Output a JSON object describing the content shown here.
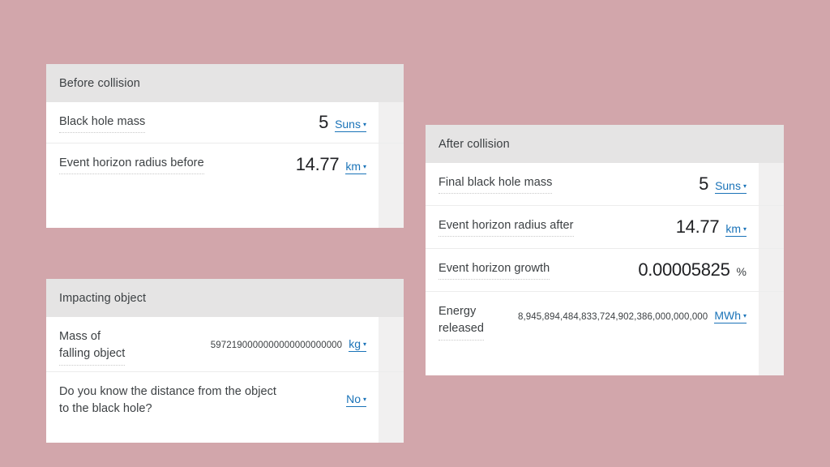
{
  "theme": {
    "background": "#d2a6ab",
    "card_background": "#ffffff",
    "header_background": "#e5e4e4",
    "link_blue": "#1a73b8",
    "text_primary": "#202124",
    "text_label": "#3c4043",
    "divider": "#ececec",
    "gutter": "#f1f0f0"
  },
  "cards": {
    "before": {
      "title": "Before collision",
      "rows": [
        {
          "label": "Black hole mass",
          "value": "5",
          "unit": "Suns",
          "unit_interactable": true,
          "value_size": "large"
        },
        {
          "label": "Event horizon radius before",
          "value": "14.77",
          "unit": "km",
          "unit_interactable": true,
          "value_size": "large"
        }
      ]
    },
    "impacting": {
      "title": "Impacting object",
      "rows": [
        {
          "label": "Mass of\nfalling object",
          "value": "5972190000000000000000000",
          "unit": "kg",
          "unit_interactable": true,
          "value_size": "small"
        },
        {
          "label": "Do you know the distance from the object\nto the black hole?",
          "value": "",
          "unit": "No",
          "unit_interactable": true,
          "value_size": "small"
        }
      ]
    },
    "after": {
      "title": "After collision",
      "rows": [
        {
          "label": "Final black hole mass",
          "value": "5",
          "unit": "Suns",
          "unit_interactable": true,
          "value_size": "large"
        },
        {
          "label": "Event horizon radius after",
          "value": "14.77",
          "unit": "km",
          "unit_interactable": true,
          "value_size": "large"
        },
        {
          "label": "Event horizon growth",
          "value": "0.00005825",
          "unit": "%",
          "unit_interactable": false,
          "value_size": "large"
        },
        {
          "label": "Energy\nreleased",
          "value": "8,945,894,484,833,724,902,386,000,000,000",
          "unit": "MWh",
          "unit_interactable": true,
          "value_size": "small"
        }
      ]
    }
  },
  "icons": {
    "caret": "▾"
  }
}
